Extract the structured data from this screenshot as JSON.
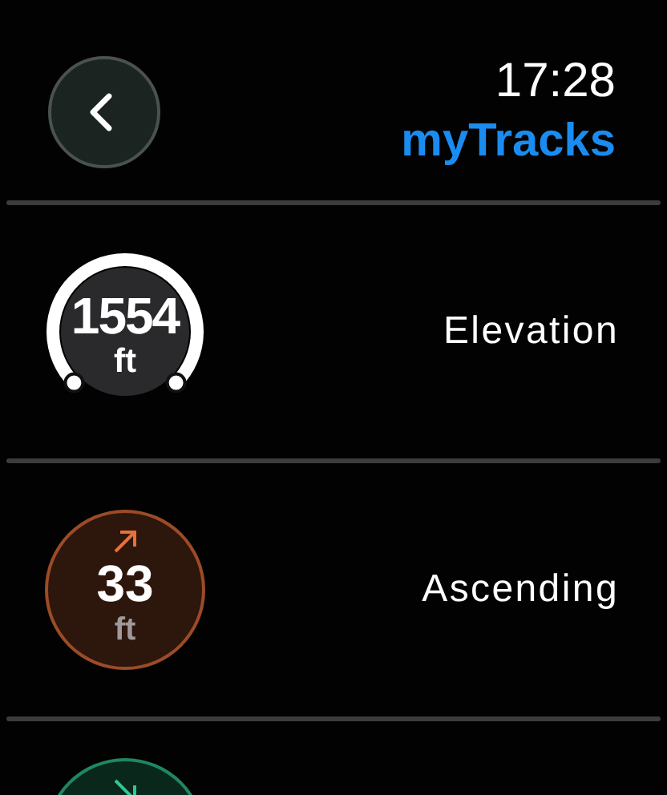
{
  "header": {
    "time": "17:28",
    "title": "myTracks"
  },
  "metrics": [
    {
      "kind": "gauge",
      "value": "1554",
      "unit": "ft",
      "label": "Elevation"
    },
    {
      "kind": "ascending",
      "value": "33",
      "unit": "ft",
      "label": "Ascending",
      "color": "#e8703a"
    },
    {
      "kind": "descending",
      "color": "#2fc890"
    }
  ]
}
